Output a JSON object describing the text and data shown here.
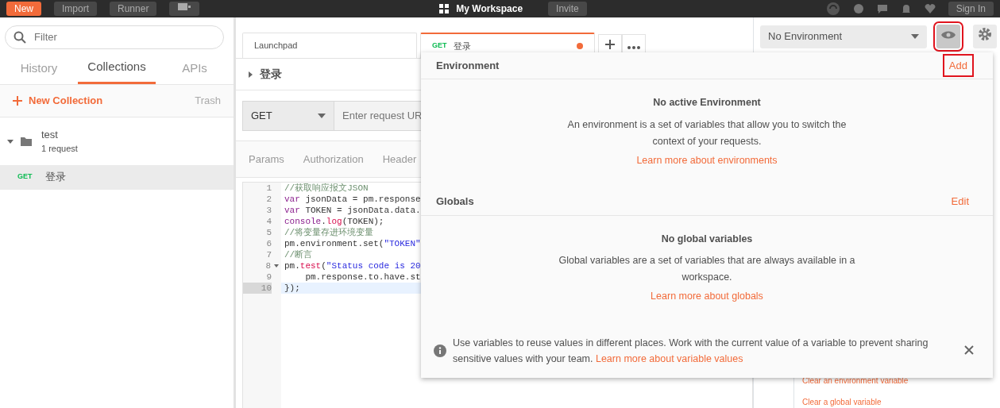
{
  "top_bar": {
    "buttons": [
      {
        "label": "New",
        "kind": "primary"
      },
      {
        "label": "Import",
        "kind": "plain"
      },
      {
        "label": "Runner",
        "kind": "plain"
      }
    ],
    "workspace": "My Workspace",
    "invite": "Invite",
    "sign_in": "Sign In"
  },
  "sidebar": {
    "filter_placeholder": "Filter",
    "tabs": [
      {
        "label": "History",
        "selected": false
      },
      {
        "label": "Collections",
        "selected": true
      },
      {
        "label": "APIs",
        "selected": false
      }
    ],
    "new_collection": "New Collection",
    "trash": "Trash",
    "collections": [
      {
        "name": "test",
        "count": "1 request",
        "expanded": true,
        "children": [
          {
            "method": "GET",
            "name": "登录",
            "selected": true
          }
        ]
      }
    ]
  },
  "request_tabs": [
    {
      "label": "Launchpad",
      "selected": false,
      "unsaved": false
    },
    {
      "method": "GET",
      "label": "登录",
      "selected": true,
      "unsaved": true
    }
  ],
  "request": {
    "title": "登录",
    "method": "GET",
    "url_placeholder": "Enter request UR"
  },
  "request_sections": [
    {
      "label": "Params"
    },
    {
      "label": "Authorization"
    },
    {
      "label": "Header"
    }
  ],
  "editor": {
    "lines": [
      {
        "number": "1",
        "foldable": false,
        "active": false,
        "tokens": [
          {
            "kind": "comment",
            "text": "//获取响应报文JSON"
          }
        ]
      },
      {
        "number": "2",
        "foldable": false,
        "active": false,
        "tokens": [
          {
            "kind": "keyword",
            "text": "var"
          },
          {
            "kind": "plain",
            "text": " jsonData = pm.response"
          }
        ]
      },
      {
        "number": "3",
        "foldable": false,
        "active": false,
        "tokens": [
          {
            "kind": "keyword",
            "text": "var"
          },
          {
            "kind": "plain",
            "text": " TOKEN = jsonData.data."
          }
        ]
      },
      {
        "number": "4",
        "foldable": false,
        "active": false,
        "tokens": [
          {
            "kind": "keyword",
            "text": "console"
          },
          {
            "kind": "plain",
            "text": "."
          },
          {
            "kind": "function",
            "text": "log"
          },
          {
            "kind": "plain",
            "text": "(TOKEN);"
          }
        ]
      },
      {
        "number": "5",
        "foldable": false,
        "active": false,
        "tokens": [
          {
            "kind": "comment",
            "text": "//将变量存进环境变量"
          }
        ]
      },
      {
        "number": "6",
        "foldable": false,
        "active": false,
        "tokens": [
          {
            "kind": "plain",
            "text": "pm.environment.set("
          },
          {
            "kind": "string",
            "text": "\"TOKEN\""
          }
        ]
      },
      {
        "number": "7",
        "foldable": false,
        "active": false,
        "tokens": [
          {
            "kind": "comment",
            "text": "//断言"
          }
        ]
      },
      {
        "number": "8",
        "foldable": true,
        "active": false,
        "tokens": [
          {
            "kind": "plain",
            "text": "pm."
          },
          {
            "kind": "function",
            "text": "test"
          },
          {
            "kind": "plain",
            "text": "("
          },
          {
            "kind": "string",
            "text": "\"Status code is 20"
          }
        ]
      },
      {
        "number": "9",
        "foldable": false,
        "active": false,
        "tokens": [
          {
            "kind": "plain",
            "text": "    pm.response.to.have.st"
          }
        ]
      },
      {
        "number": "10",
        "foldable": false,
        "active": true,
        "tokens": [
          {
            "kind": "plain",
            "text": "});"
          }
        ]
      }
    ]
  },
  "environment": {
    "selector": "No Environment",
    "quick_look_highlighted": true
  },
  "side_snippets": [
    "Clear an environment variable",
    "Clear a global variable"
  ],
  "popup": {
    "sections": [
      {
        "title": "Environment",
        "action": "Add",
        "action_highlighted": true,
        "empty_title": "No active Environment",
        "description": "An environment is a set of variables that allow you to switch the context of your requests.",
        "link": "Learn more about environments"
      },
      {
        "title": "Globals",
        "action": "Edit",
        "action_highlighted": false,
        "empty_title": "No global variables",
        "description": "Global variables are a set of variables that are always available in a workspace.",
        "link": "Learn more about globals"
      }
    ],
    "info": {
      "text": "Use variables to reuse values in different places. Work with the current value of a variable to prevent sharing sensitive values with your team. ",
      "link": "Learn more about variable values"
    }
  }
}
